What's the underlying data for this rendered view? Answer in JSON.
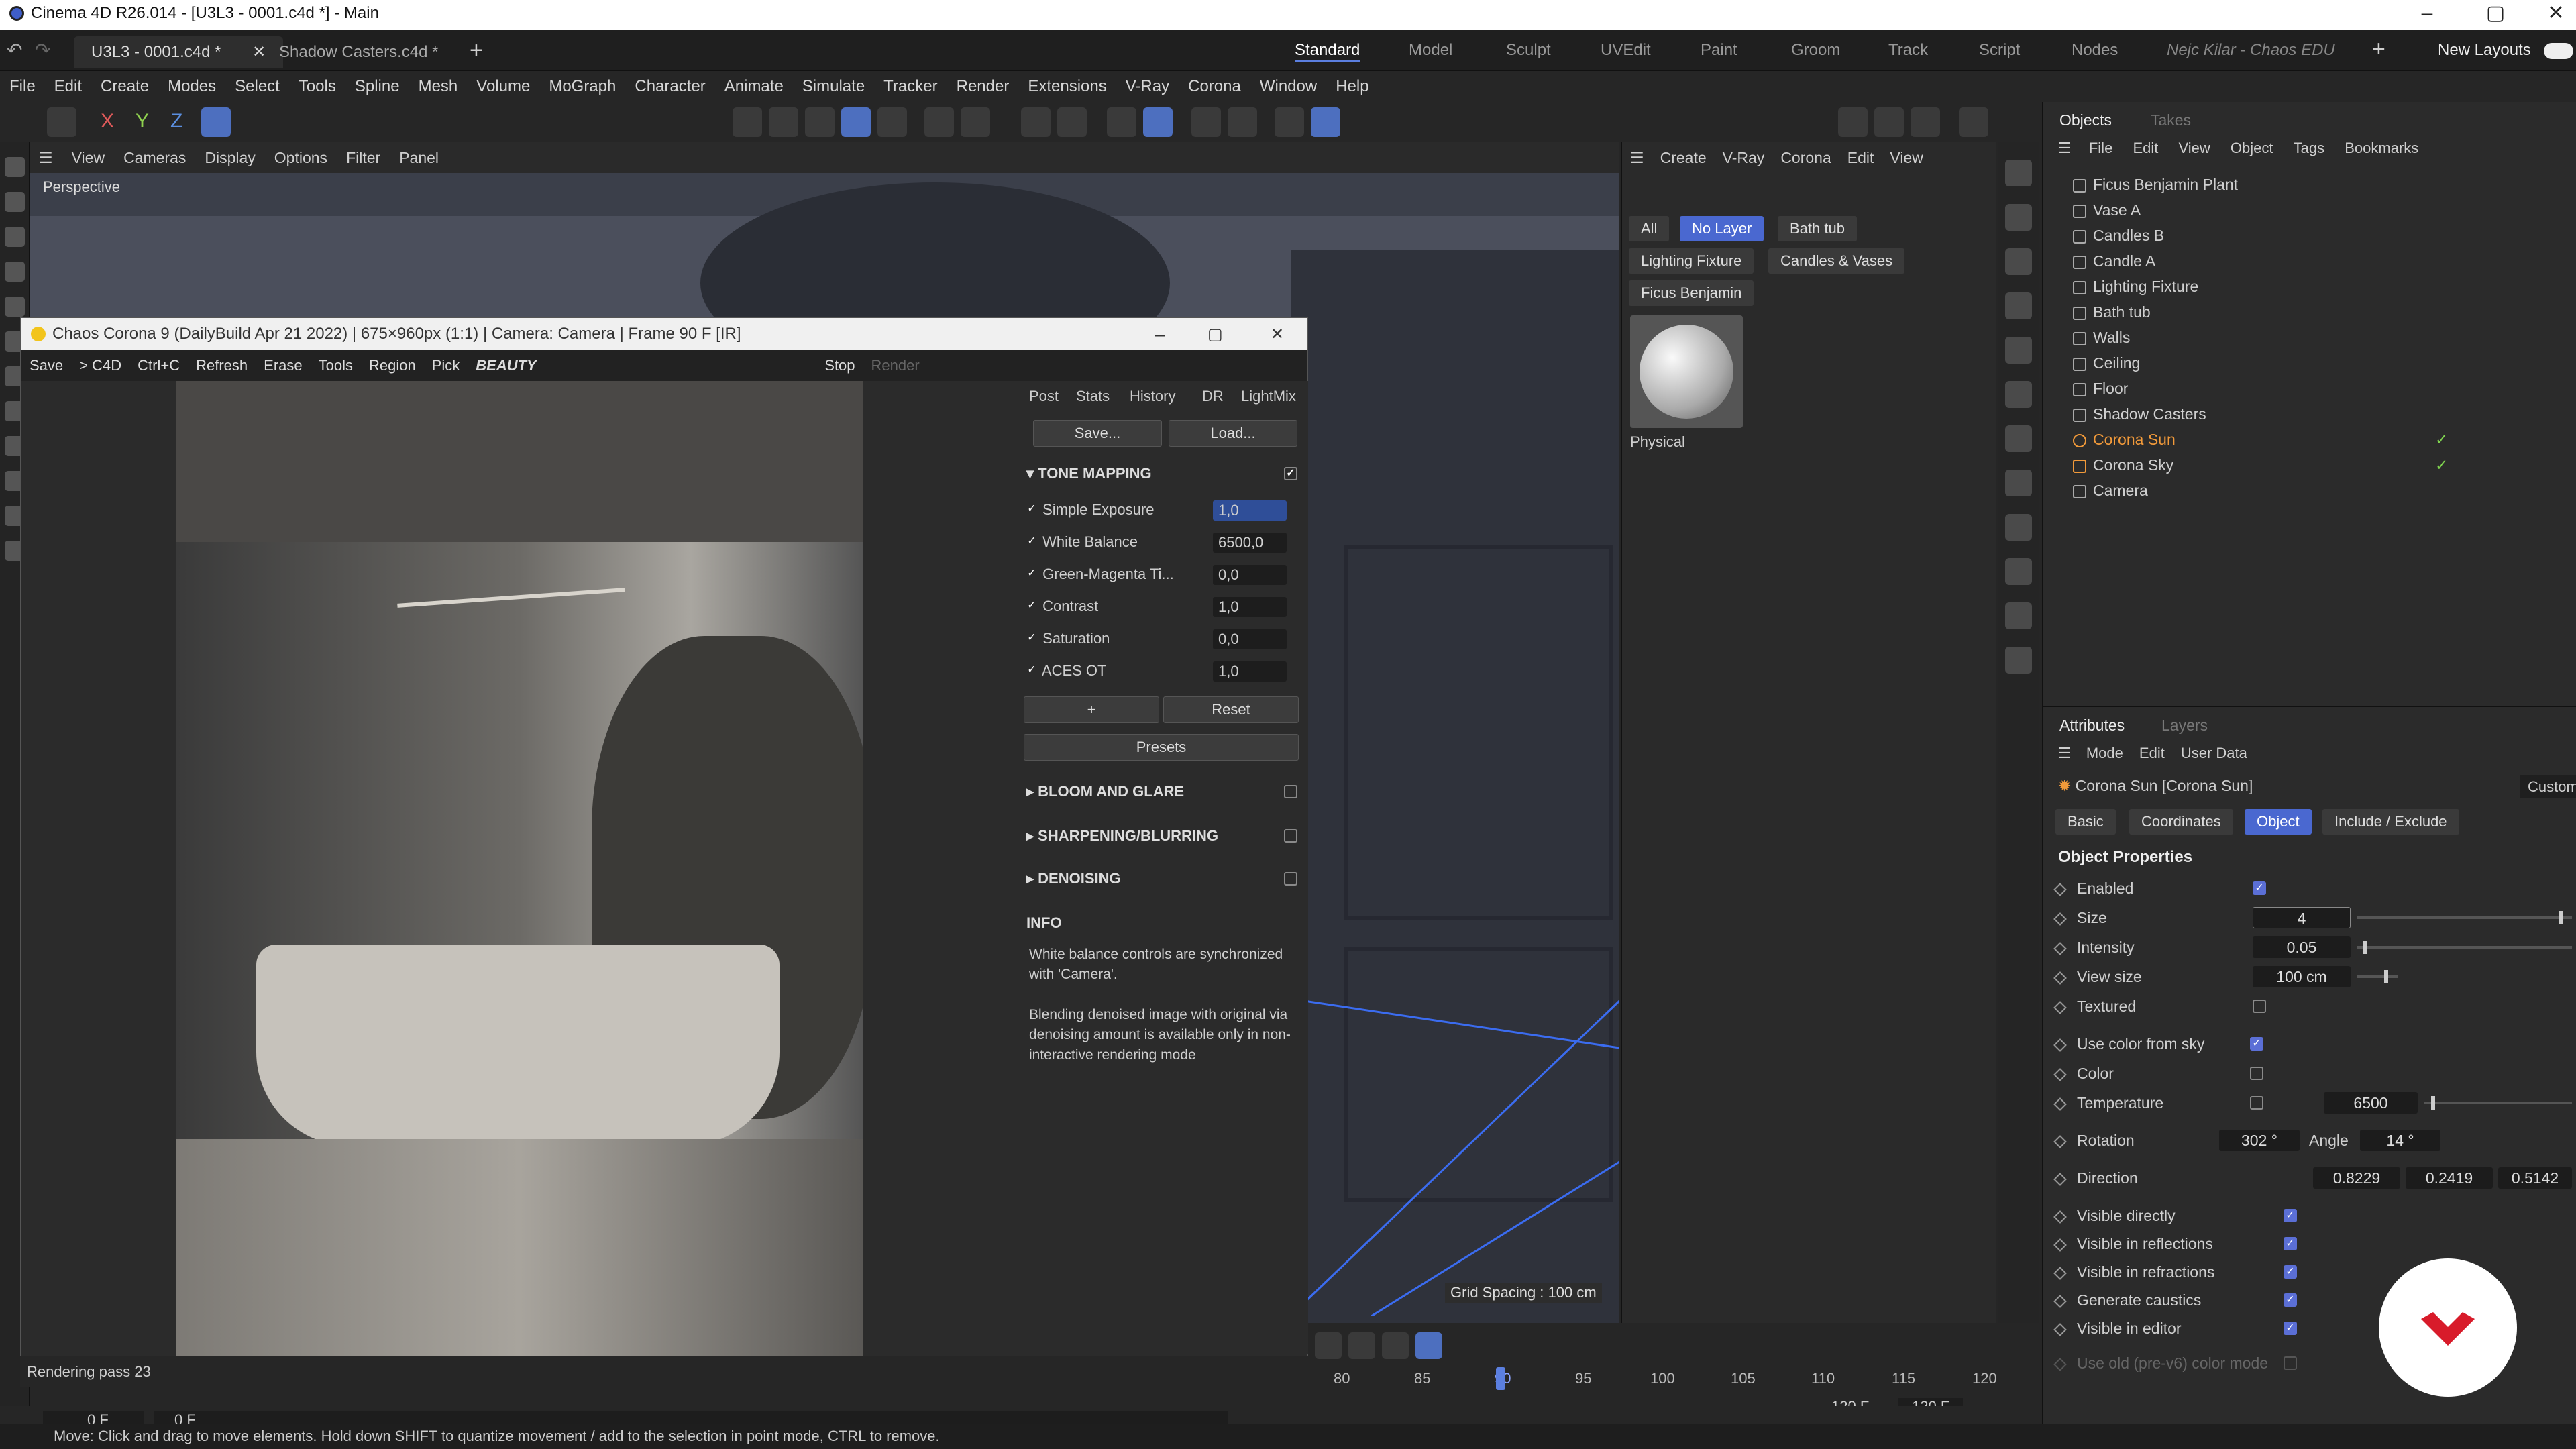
{
  "window": {
    "title": "Cinema 4D R26.014 - [U3L3 - 0001.c4d *] - Main"
  },
  "doc_tabs": [
    "U3L3 - 0001.c4d *",
    "Shadow Casters.c4d *"
  ],
  "layouts": [
    "Standard",
    "Model",
    "Sculpt",
    "UVEdit",
    "Paint",
    "Groom",
    "Track",
    "Script",
    "Nodes"
  ],
  "user": "Nejc Kilar - Chaos EDU",
  "new_layouts": "New Layouts",
  "menu": [
    "File",
    "Edit",
    "Create",
    "Modes",
    "Select",
    "Tools",
    "Spline",
    "Mesh",
    "Volume",
    "MoGraph",
    "Character",
    "Animate",
    "Simulate",
    "Tracker",
    "Render",
    "Extensions",
    "V-Ray",
    "Corona",
    "Window",
    "Help"
  ],
  "axis": {
    "x": "X",
    "y": "Y",
    "z": "Z"
  },
  "viewport": {
    "menu": [
      "View",
      "Cameras",
      "Display",
      "Options",
      "Filter",
      "Panel"
    ],
    "label": "Perspective",
    "grid": "Grid Spacing : 100 cm"
  },
  "vfb": {
    "title": "Chaos Corona 9 (DailyBuild Apr 21 2022) | 675×960px (1:1) | Camera: Camera | Frame 90 F [IR]",
    "toolbar": [
      "Save",
      "> C4D",
      "Ctrl+C",
      "Refresh",
      "Erase",
      "Tools",
      "Region",
      "Pick"
    ],
    "pass": "BEAUTY",
    "stop": "Stop",
    "render": "Render",
    "tabs": [
      "Post",
      "Stats",
      "History",
      "DR",
      "LightMix"
    ],
    "save": "Save...",
    "load": "Load...",
    "tone_mapping": "TONE MAPPING",
    "params": [
      {
        "label": "Simple Exposure",
        "value": "1,0"
      },
      {
        "label": "White Balance",
        "value": "6500,0"
      },
      {
        "label": "Green-Magenta Ti...",
        "value": "0,0"
      },
      {
        "label": "Contrast",
        "value": "1,0"
      },
      {
        "label": "Saturation",
        "value": "0,0"
      },
      {
        "label": "ACES OT",
        "value": "1,0"
      }
    ],
    "plus": "+",
    "reset": "Reset",
    "presets": "Presets",
    "sections": [
      "BLOOM AND GLARE",
      "SHARPENING/BLURRING",
      "DENOISING"
    ],
    "info_title": "INFO",
    "info1": "White balance controls are synchronized with 'Camera'.",
    "info2": "Blending denoised image with original via denoising amount is available only in non-interactive rendering mode",
    "status": "Rendering pass 23"
  },
  "layers": {
    "menu": [
      "Create",
      "V-Ray",
      "Corona",
      "Edit",
      "View"
    ],
    "chips": [
      "All",
      "No Layer",
      "Bath tub",
      "Lighting Fixture",
      "Candles & Vases",
      "Ficus Benjamin"
    ],
    "material": "Physical"
  },
  "objects": {
    "tabs": [
      "Objects",
      "Takes"
    ],
    "menu": [
      "File",
      "Edit",
      "View",
      "Object",
      "Tags",
      "Bookmarks"
    ],
    "items": [
      "Ficus Benjamin Plant",
      "Vase A",
      "Candles B",
      "Candle A",
      "Lighting Fixture",
      "Bath tub",
      "Walls",
      "Ceiling",
      "Floor",
      "Shadow Casters",
      "Corona Sun",
      "Corona Sky",
      "Camera"
    ]
  },
  "attributes": {
    "tabs": [
      "Attributes",
      "Layers"
    ],
    "menu": [
      "Mode",
      "Edit",
      "User Data"
    ],
    "object": "Corona Sun [Corona Sun]",
    "preset": "Custom",
    "subtabs": [
      "Basic",
      "Coordinates",
      "Object",
      "Include / Exclude"
    ],
    "section": "Object Properties",
    "enabled": "Enabled",
    "size": "Size",
    "size_v": "4",
    "intensity": "Intensity",
    "intensity_v": "0.05",
    "view_size": "View size",
    "view_size_v": "100 cm",
    "textured": "Textured",
    "use_sky": "Use color from sky",
    "color": "Color",
    "temperature": "Temperature",
    "temperature_v": "6500",
    "rotation": "Rotation",
    "rotation_v": "302 °",
    "angle": "Angle",
    "angle_v": "14 °",
    "direction": "Direction",
    "dir": [
      "0.8229",
      "0.2419",
      "0.5142"
    ],
    "vis": [
      "Visible directly",
      "Visible in reflections",
      "Visible in refractions",
      "Generate caustics",
      "Visible in editor"
    ],
    "old": "Use old (pre-v6) color mode"
  },
  "timeline": {
    "ticks": [
      "80",
      "85",
      "90",
      "95",
      "100",
      "105",
      "110",
      "115",
      "120"
    ],
    "start": "0 F",
    "start2": "0 F",
    "end": "120 F",
    "end2": "120 F"
  },
  "hint": "Move: Click and drag to move elements. Hold down SHIFT to quantize movement / add to the selection in point mode, CTRL to remove."
}
